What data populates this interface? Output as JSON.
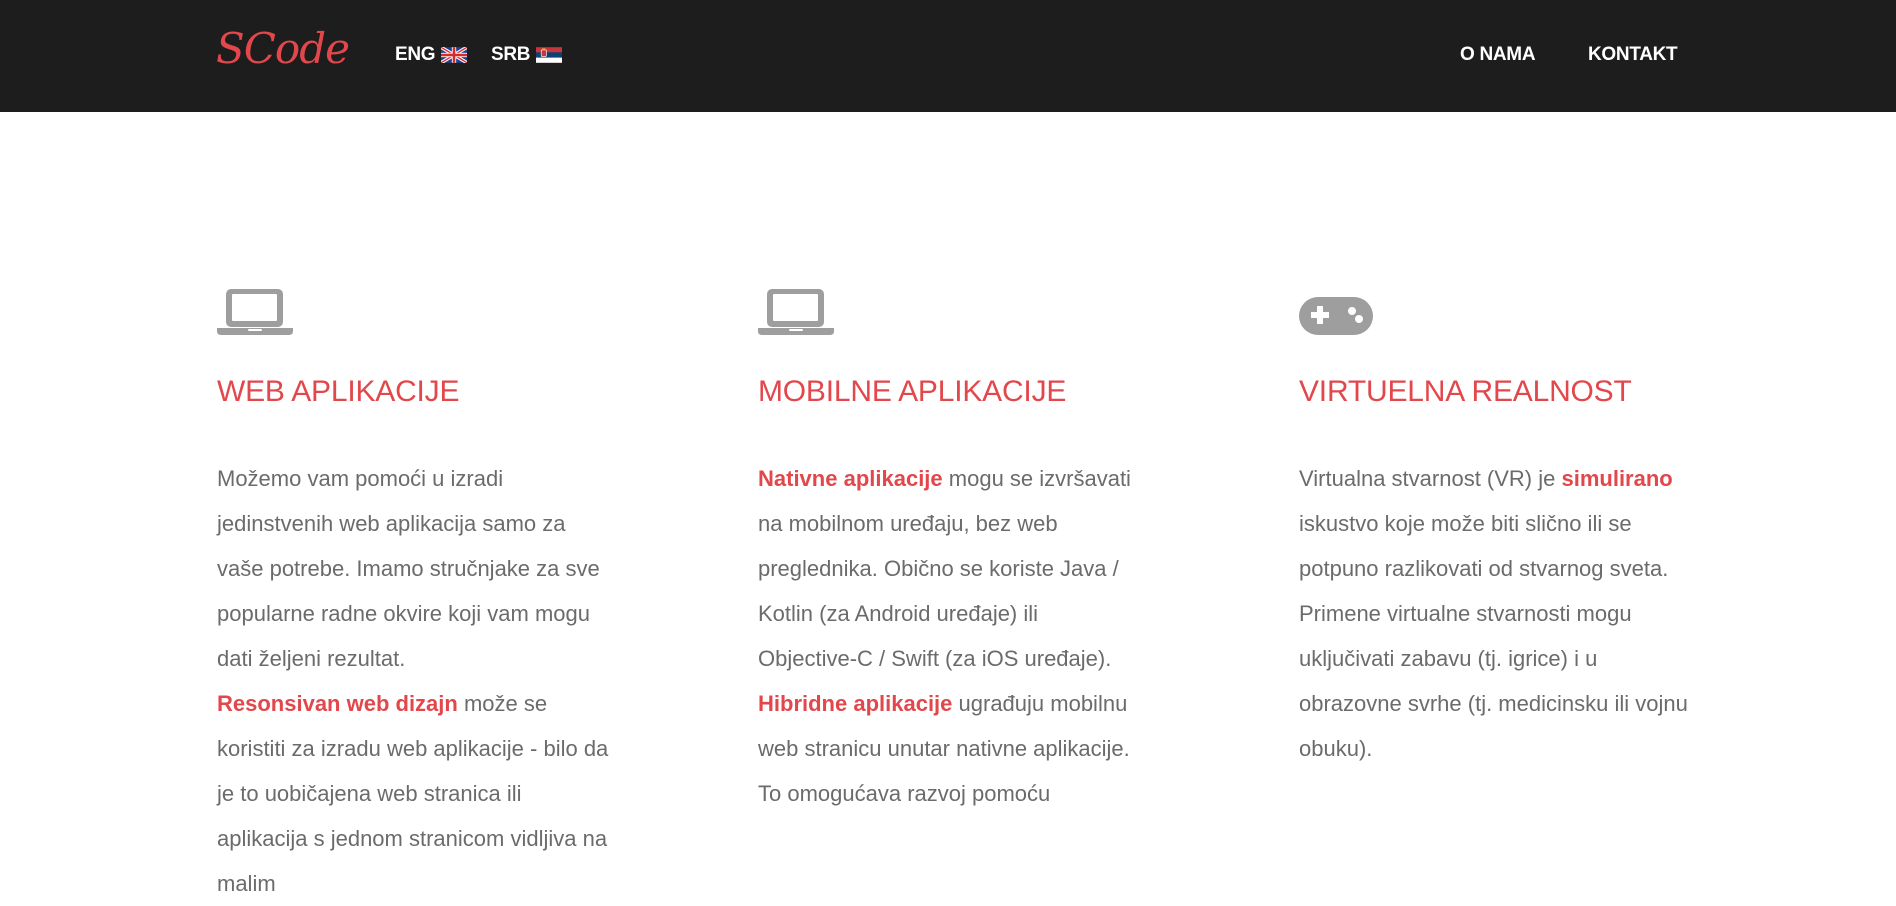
{
  "header": {
    "logo": "SCode",
    "languages": [
      {
        "label": "ENG",
        "flag": "uk-flag-icon"
      },
      {
        "label": "SRB",
        "flag": "serbia-flag-icon"
      }
    ],
    "nav": {
      "about": "O NAMA",
      "contact": "KONTAKT"
    }
  },
  "colors": {
    "accent": "#e2474c",
    "header_bg": "#1d1d1d",
    "text": "#6b6b6b",
    "icon": "#9e9e9e"
  },
  "services": [
    {
      "icon": "laptop-icon",
      "title": "WEB APLIKACIJE",
      "p1": "Možemo vam pomoći u izradi jedinstvenih web aplikacija samo za vaše potrebe. Imamo stručnjake za sve popularne radne okvire koji vam mogu dati željeni rezultat.",
      "hl1": "Resonsivan web dizajn",
      "p2": " može se koristiti za izradu web aplikacije - bilo da je to uobičajena web stranica ili aplikacija s jednom stranicom vidljiva na malim"
    },
    {
      "icon": "laptop-icon",
      "title": "MOBILNE APLIKACIJE",
      "hl1": "Nativne aplikacije",
      "p1": " mogu se izvršavati na mobilnom uređaju, bez web preglednika. Obično se koriste Java / Kotlin (za Android uređaje) ili Objective-C / Swift (za iOS uređaje).",
      "hl2": "Hibridne aplikacije",
      "p2": " ugrađuju mobilnu web stranicu unutar nativne aplikacije.",
      "p3": "To omogućava razvoj pomoću"
    },
    {
      "icon": "gamepad-icon",
      "title": "VIRTUELNA REALNOST",
      "p1": "Virtualna stvarnost (VR) je ",
      "hl1": "simulirano",
      "p2": " iskustvo koje može biti slično ili se potpuno razlikovati od stvarnog sveta. Primene virtualne stvarnosti mogu uključivati zabavu (tj. igrice) i u obrazovne svrhe (tj. medicinsku ili vojnu obuku)."
    }
  ]
}
